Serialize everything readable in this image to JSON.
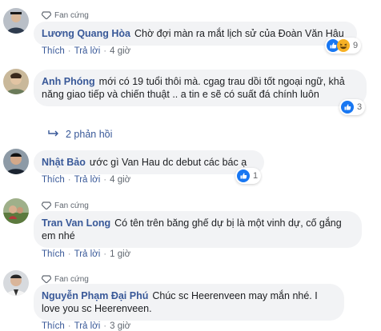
{
  "comments": [
    {
      "fan_tag": "Fan cứng",
      "author": "Lương Quang Hòa",
      "text": "Chờ đợi màn ra mắt lịch sử của Đoàn Văn Hậu",
      "like": "Thích",
      "reply": "Trả lời",
      "time": "4 giờ",
      "reaction_icons": [
        "like-icon",
        "haha-icon"
      ],
      "reaction_count": "9"
    },
    {
      "fan_tag": "",
      "author": "Anh Phóng",
      "text": "mới có 19 tuổi thôi mà. cgag trau dồi tốt ngoại ngữ, khả năng giao tiếp và chiến thuật .. a tin e sẽ có suất đá chính luôn",
      "like": "",
      "reply": "",
      "time": "",
      "reaction_icons": [
        "like-icon"
      ],
      "reaction_count": "3",
      "replies_label": "2 phản hồi"
    },
    {
      "fan_tag": "",
      "author": "Nhật Bảo",
      "text": "ước gì Van Hau dc debut các bác ạ",
      "like": "Thích",
      "reply": "Trả lời",
      "time": "4 giờ",
      "reaction_icons": [
        "like-icon"
      ],
      "reaction_count": "1"
    },
    {
      "fan_tag": "Fan cứng",
      "author": "Tran Van Long",
      "text": "Có tên trên băng ghế dự bị là một vinh dự, cố gắng em nhé",
      "like": "Thích",
      "reply": "Trả lời",
      "time": "1 giờ",
      "reaction_icons": [],
      "reaction_count": ""
    },
    {
      "fan_tag": "Fan cứng",
      "author": "Nguyễn Phạm Đại Phú",
      "text": "Chúc sc Heerenveen may mắn nhé. I love you sc Heerenveen.",
      "like": "Thích",
      "reply": "Trả lời",
      "time": "3 giờ",
      "reaction_icons": [],
      "reaction_count": ""
    }
  ],
  "colors": {
    "link": "#385898",
    "bubble": "#f2f3f5",
    "like": "#1877f2",
    "haha": "#f7b125",
    "meta": "#606770"
  }
}
